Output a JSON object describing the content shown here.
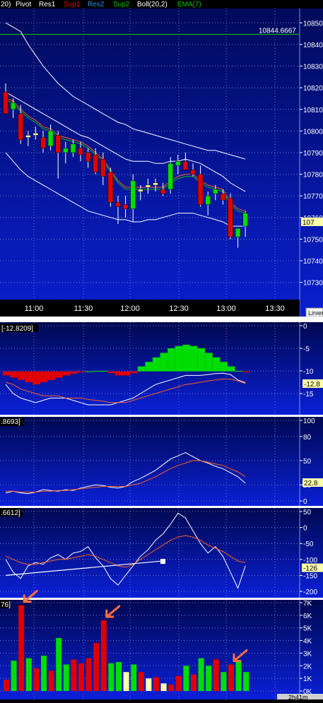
{
  "header": {
    "items": [
      {
        "label": "20)",
        "color": "#ffffff"
      },
      {
        "label": "Pivot",
        "color": "#ffffff"
      },
      {
        "label": "Res1",
        "color": "#ffffff"
      },
      {
        "label": "Sup1",
        "color": "#e00000"
      },
      {
        "label": "Res2",
        "color": "#1e90ff"
      },
      {
        "label": "Sup2",
        "color": "#00c000"
      },
      {
        "label": "Boll(20,2)",
        "color": "#ffffff"
      },
      {
        "label": "EMA(7)",
        "color": "#00c000"
      }
    ]
  },
  "colors": {
    "panel_bg_top": "#000a5a",
    "panel_bg_bottom": "#0a1fd0",
    "up_candle": "#00dd00",
    "down_candle": "#e00000",
    "doji_candle": "#ffffaa",
    "bollinger": "#ffffff",
    "ema": "#ff6020",
    "ema_green": "#00c000",
    "arrow": "#ff7040"
  },
  "price_panel": {
    "res_line_label": "10844.6667",
    "last_price_label": "107",
    "scale_button": "Linier",
    "y_ticks": [
      "10850",
      "10840",
      "10830",
      "10820",
      "10810",
      "10800",
      "10790",
      "10780",
      "10770",
      "10760",
      "10750",
      "10740",
      "10730"
    ],
    "x_ticks": [
      "11:00",
      "11:30",
      "12:00",
      "12:30",
      "13:00",
      "13:30"
    ],
    "chart_data": {
      "type": "candlestick",
      "ylim": [
        10725,
        10855
      ],
      "res_level": 10844.6667,
      "candles": [
        {
          "o": 10818,
          "h": 10822,
          "l": 10808,
          "c": 10808
        },
        {
          "o": 10810,
          "h": 10815,
          "l": 10806,
          "c": 10813
        },
        {
          "o": 10808,
          "h": 10812,
          "l": 10794,
          "c": 10796
        },
        {
          "o": 10797,
          "h": 10800,
          "l": 10793,
          "c": 10798
        },
        {
          "o": 10798,
          "h": 10802,
          "l": 10796,
          "c": 10799
        },
        {
          "o": 10797,
          "h": 10800,
          "l": 10790,
          "c": 10792
        },
        {
          "o": 10793,
          "h": 10803,
          "l": 10791,
          "c": 10800
        },
        {
          "o": 10798,
          "h": 10800,
          "l": 10778,
          "c": 10790
        },
        {
          "o": 10790,
          "h": 10795,
          "l": 10785,
          "c": 10792
        },
        {
          "o": 10790,
          "h": 10796,
          "l": 10788,
          "c": 10794
        },
        {
          "o": 10792,
          "h": 10795,
          "l": 10786,
          "c": 10789
        },
        {
          "o": 10790,
          "h": 10792,
          "l": 10783,
          "c": 10786
        },
        {
          "o": 10789,
          "h": 10792,
          "l": 10780,
          "c": 10781
        },
        {
          "o": 10787,
          "h": 10790,
          "l": 10775,
          "c": 10779
        },
        {
          "o": 10781,
          "h": 10783,
          "l": 10765,
          "c": 10767
        },
        {
          "o": 10767,
          "h": 10770,
          "l": 10757,
          "c": 10765
        },
        {
          "o": 10766,
          "h": 10770,
          "l": 10760,
          "c": 10764
        },
        {
          "o": 10764,
          "h": 10780,
          "l": 10758,
          "c": 10777
        },
        {
          "o": 10772,
          "h": 10775,
          "l": 10768,
          "c": 10773
        },
        {
          "o": 10774,
          "h": 10778,
          "l": 10771,
          "c": 10775
        },
        {
          "o": 10775,
          "h": 10778,
          "l": 10772,
          "c": 10776
        },
        {
          "o": 10773,
          "h": 10776,
          "l": 10770,
          "c": 10771
        },
        {
          "o": 10773,
          "h": 10788,
          "l": 10771,
          "c": 10785
        },
        {
          "o": 10784,
          "h": 10789,
          "l": 10780,
          "c": 10786
        },
        {
          "o": 10786,
          "h": 10790,
          "l": 10782,
          "c": 10782
        },
        {
          "o": 10782,
          "h": 10785,
          "l": 10779,
          "c": 10780
        },
        {
          "o": 10780,
          "h": 10784,
          "l": 10765,
          "c": 10766
        },
        {
          "o": 10766,
          "h": 10772,
          "l": 10761,
          "c": 10770
        },
        {
          "o": 10771,
          "h": 10775,
          "l": 10768,
          "c": 10773
        },
        {
          "o": 10771,
          "h": 10773,
          "l": 10766,
          "c": 10768
        },
        {
          "o": 10769,
          "h": 10771,
          "l": 10750,
          "c": 10751
        },
        {
          "o": 10751,
          "h": 10755,
          "l": 10746,
          "c": 10755
        },
        {
          "o": 10756,
          "h": 10763,
          "l": 10751,
          "c": 10762
        }
      ],
      "boll_upper": [
        10850,
        10848,
        10846,
        10840,
        10835,
        10830,
        10826,
        10822,
        10819,
        10816,
        10814,
        10812,
        10810,
        10808,
        10806,
        10804,
        10803,
        10801,
        10800,
        10799,
        10798,
        10797,
        10796,
        10795,
        10794,
        10793,
        10792,
        10791,
        10791,
        10790,
        10789,
        10788,
        10787
      ],
      "boll_mid": [
        10818,
        10816,
        10814,
        10812,
        10810,
        10808,
        10806,
        10804,
        10802,
        10800,
        10798,
        10797,
        10795,
        10793,
        10791,
        10789,
        10787,
        10786,
        10786,
        10786,
        10785,
        10785,
        10786,
        10786,
        10787,
        10786,
        10785,
        10783,
        10781,
        10779,
        10776,
        10774,
        10772
      ],
      "boll_lower": [
        10790,
        10786,
        10782,
        10779,
        10777,
        10775,
        10773,
        10771,
        10769,
        10767,
        10765,
        10763,
        10762,
        10761,
        10760,
        10759,
        10759,
        10758,
        10758,
        10759,
        10759,
        10760,
        10761,
        10762,
        10762,
        10762,
        10761,
        10760,
        10759,
        10758,
        10756,
        10756,
        10756
      ],
      "ema": [
        10815,
        10814,
        10810,
        10807,
        10805,
        10802,
        10801,
        10798,
        10797,
        10796,
        10795,
        10793,
        10790,
        10787,
        10782,
        10777,
        10774,
        10774,
        10774,
        10774,
        10774,
        10774,
        10777,
        10779,
        10780,
        10780,
        10777,
        10775,
        10774,
        10773,
        10767,
        10764,
        10763
      ]
    }
  },
  "macd_panel": {
    "label": "[-12.8209]",
    "value_badge": "-12.8",
    "y_ticks": [
      "0",
      "-5",
      "-10",
      "-15"
    ],
    "chart_data": {
      "type": "histogram+line",
      "ylim": [
        -20,
        1
      ],
      "histogram": [
        -11,
        -11.5,
        -12,
        -12.5,
        -13,
        -12.5,
        -12,
        -11.5,
        -11,
        -10.6,
        -10.3,
        -10.1,
        -10,
        -10,
        -10.5,
        -11,
        -11,
        -10.5,
        -9,
        -8,
        -7,
        -6,
        -5,
        -4.5,
        -4.2,
        -4.5,
        -5,
        -6,
        -7,
        -8,
        -9,
        -10,
        -10.3
      ],
      "line1": [
        -13,
        -15,
        -16,
        -16.5,
        -17,
        -16.5,
        -16,
        -16,
        -16,
        -16.5,
        -17,
        -17.5,
        -17.5,
        -17.5,
        -17.5,
        -17,
        -16.5,
        -16,
        -15,
        -14,
        -13,
        -12.5,
        -12,
        -11.5,
        -11,
        -11,
        -11,
        -10.8,
        -10.6,
        -10.5,
        -10.8,
        -12,
        -12.6
      ],
      "line2": [
        -12.5,
        -13,
        -14,
        -14.5,
        -15,
        -15.5,
        -15.5,
        -15.5,
        -16,
        -16,
        -16,
        -16.3,
        -16.5,
        -16.7,
        -17,
        -17,
        -17,
        -16.5,
        -16,
        -15.5,
        -15,
        -14.5,
        -14,
        -13.5,
        -13,
        -12.8,
        -12.5,
        -12.2,
        -12,
        -11.8,
        -11.8,
        -12.2,
        -12.8
      ]
    }
  },
  "rsi_panel": {
    "label": ".8693]",
    "value_badge": "22.8",
    "y_ticks": [
      "100",
      "80",
      "50",
      "20",
      "0"
    ],
    "chart_data": {
      "type": "line",
      "ylim": [
        0,
        100
      ],
      "line1": [
        10,
        12,
        10,
        9,
        11,
        14,
        13,
        12,
        14,
        13,
        16,
        18,
        20,
        19,
        17,
        16,
        18,
        24,
        28,
        33,
        38,
        45,
        52,
        56,
        60,
        55,
        50,
        47,
        43,
        40,
        35,
        30,
        22
      ],
      "line2": [
        12,
        12,
        11,
        11,
        11,
        12,
        12,
        13,
        13,
        14,
        15,
        16,
        17,
        18,
        18,
        18,
        18,
        20,
        22,
        26,
        30,
        35,
        40,
        44,
        47,
        50,
        50,
        48,
        46,
        44,
        40,
        36,
        30
      ]
    }
  },
  "cci_panel": {
    "label": ".6612]",
    "value_badge": "-126",
    "y_ticks": [
      "50",
      "0",
      "-50",
      "-100",
      "-150",
      "-200"
    ],
    "chart_data": {
      "type": "line",
      "ylim": [
        -215,
        50
      ],
      "line1": [
        -100,
        -140,
        -160,
        -120,
        -110,
        -115,
        -95,
        -85,
        -100,
        -80,
        -75,
        -60,
        -95,
        -120,
        -160,
        -180,
        -150,
        -120,
        -90,
        -70,
        -40,
        -20,
        10,
        45,
        30,
        -10,
        -50,
        -80,
        -60,
        -90,
        -140,
        -190,
        -120
      ],
      "line2": [
        -90,
        -100,
        -110,
        -115,
        -115,
        -110,
        -105,
        -100,
        -100,
        -95,
        -90,
        -85,
        -90,
        -100,
        -110,
        -120,
        -125,
        -115,
        -100,
        -85,
        -70,
        -55,
        -40,
        -30,
        -25,
        -30,
        -40,
        -55,
        -65,
        -75,
        -90,
        -105,
        -110
      ],
      "trend": [
        -150,
        -105
      ]
    }
  },
  "volume_panel": {
    "label": "76]",
    "y_ticks": [
      "7K",
      "6K",
      "5K",
      "4K",
      "3K",
      "2K",
      "1K",
      "0K"
    ],
    "time_tab": "2h41m",
    "chart_data": {
      "type": "bar",
      "ylim": [
        0,
        7500
      ],
      "values": [
        900,
        2400,
        6800,
        2600,
        1800,
        2800,
        1600,
        4200,
        2100,
        2500,
        2200,
        2600,
        3800,
        5600,
        2200,
        2300,
        1500,
        2100,
        1500,
        1000,
        1100,
        600,
        500,
        1200,
        2000,
        1300,
        2600,
        2000,
        2500,
        1500,
        2100,
        2400,
        1500
      ],
      "colors": [
        "r",
        "g",
        "r",
        "g",
        "r",
        "g",
        "r",
        "g",
        "g",
        "r",
        "r",
        "r",
        "r",
        "r",
        "g",
        "g",
        "y",
        "g",
        "r",
        "y",
        "r",
        "y",
        "r",
        "r",
        "g",
        "r",
        "g",
        "g",
        "r",
        "g",
        "r",
        "g",
        "g"
      ]
    },
    "arrows_at": [
      2,
      13,
      30
    ]
  }
}
